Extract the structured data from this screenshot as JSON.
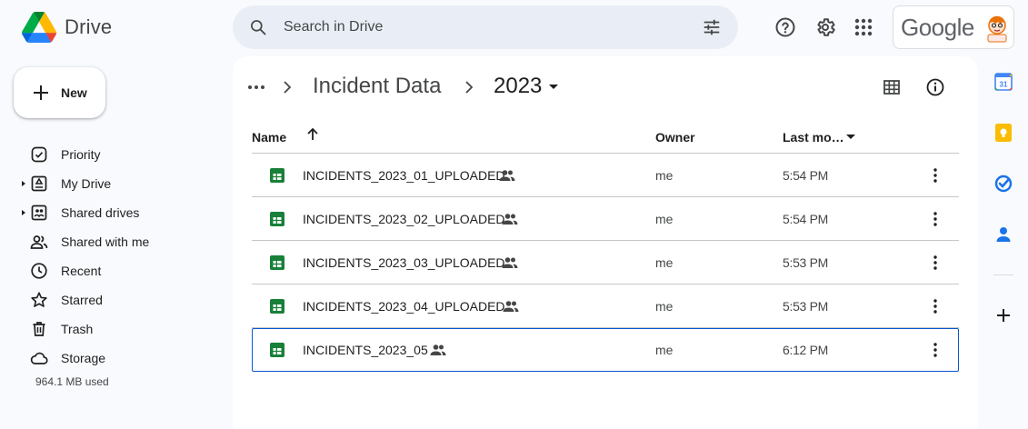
{
  "app": {
    "name": "Drive"
  },
  "search": {
    "placeholder": "Search in Drive"
  },
  "account": {
    "brand_text": "Google"
  },
  "sidebar": {
    "new_label": "New",
    "items": [
      {
        "label": "Priority",
        "icon": "priority-icon",
        "expandable": false
      },
      {
        "label": "My Drive",
        "icon": "my-drive-icon",
        "expandable": true
      },
      {
        "label": "Shared drives",
        "icon": "shared-drives-icon",
        "expandable": true
      },
      {
        "label": "Shared with me",
        "icon": "shared-with-me-icon",
        "expandable": false
      },
      {
        "label": "Recent",
        "icon": "recent-icon",
        "expandable": false
      },
      {
        "label": "Starred",
        "icon": "starred-icon",
        "expandable": false
      },
      {
        "label": "Trash",
        "icon": "trash-icon",
        "expandable": false
      },
      {
        "label": "Storage",
        "icon": "storage-icon",
        "expandable": false
      }
    ],
    "storage_used": "964.1 MB used"
  },
  "breadcrumb": {
    "items": [
      "Incident Data",
      "2023"
    ]
  },
  "table": {
    "columns": {
      "name": "Name",
      "owner": "Owner",
      "modified": "Last mo…"
    },
    "rows": [
      {
        "name": "INCIDENTS_2023_01_UPLOADED",
        "owner": "me",
        "modified": "5:54 PM",
        "shared": true,
        "selected": false
      },
      {
        "name": "INCIDENTS_2023_02_UPLOADED",
        "owner": "me",
        "modified": "5:54 PM",
        "shared": true,
        "selected": false
      },
      {
        "name": "INCIDENTS_2023_03_UPLOADED",
        "owner": "me",
        "modified": "5:53 PM",
        "shared": true,
        "selected": false
      },
      {
        "name": "INCIDENTS_2023_04_UPLOADED",
        "owner": "me",
        "modified": "5:53 PM",
        "shared": true,
        "selected": false
      },
      {
        "name": "INCIDENTS_2023_05",
        "owner": "me",
        "modified": "6:12 PM",
        "shared": true,
        "selected": true
      }
    ]
  },
  "side_panel": {
    "apps": [
      "calendar-icon",
      "keep-icon",
      "tasks-icon",
      "contacts-icon"
    ],
    "calendar_day": "31"
  },
  "colors": {
    "background": "#f8fafd",
    "search_bg": "#e9eef6",
    "sheets_green": "#188038",
    "selection_blue": "#0b57d0"
  }
}
